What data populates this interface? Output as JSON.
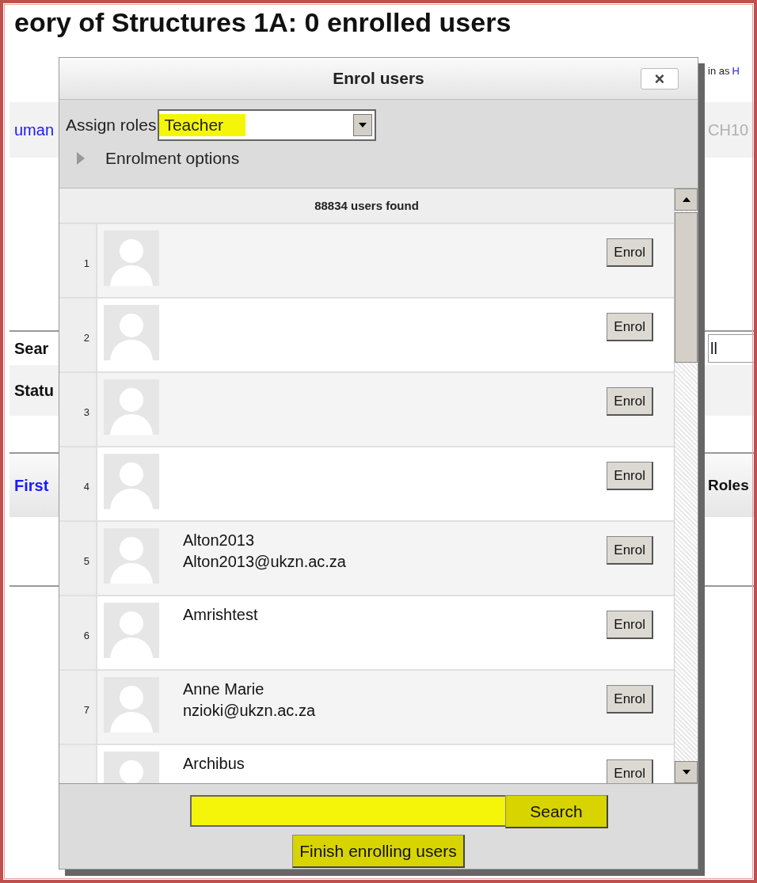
{
  "page": {
    "title": "eory of Structures 1A: 0 enrolled users",
    "login_text": "in as",
    "login_link": "H",
    "breadcrumb_link": "uman",
    "course_code": "CH10",
    "search_label": "Sear",
    "search_value": "ll",
    "status_label": "Statu",
    "table_columns": [
      {
        "label": "First",
        "kind": "link"
      },
      {
        "label": "Roles",
        "kind": "plain"
      }
    ]
  },
  "dialog": {
    "title": "Enrol users",
    "close": "×",
    "assign_roles_label": "Assign roles",
    "role_select": {
      "value": "Teacher",
      "highlighted": true
    },
    "enrolment_options": {
      "label": "Enrolment options",
      "expanded": false
    },
    "results_count": "88834 users found",
    "users": [
      {
        "number": "1",
        "enrol": "Enrol"
      },
      {
        "number": "2",
        "enrol": "Enrol"
      },
      {
        "number": "3",
        "enrol": "Enrol"
      },
      {
        "number": "4",
        "enrol": "Enrol"
      },
      {
        "number": "5",
        "name": "Alton2013",
        "email": "Alton2013@ukzn.ac.za",
        "enrol": "Enrol"
      },
      {
        "number": "6",
        "name": "Amrishtest",
        "enrol": "Enrol"
      },
      {
        "number": "7",
        "name": "Anne Marie",
        "email": "nzioki@ukzn.ac.za",
        "enrol": "Enrol"
      },
      {
        "name": "Archibus",
        "enrol": "Enrol"
      }
    ],
    "search_field": {
      "highlighted": true
    },
    "search_button": {
      "label": "Search",
      "highlighted": true
    },
    "finish_button": {
      "label": "Finish enrolling users",
      "highlighted": true
    }
  }
}
